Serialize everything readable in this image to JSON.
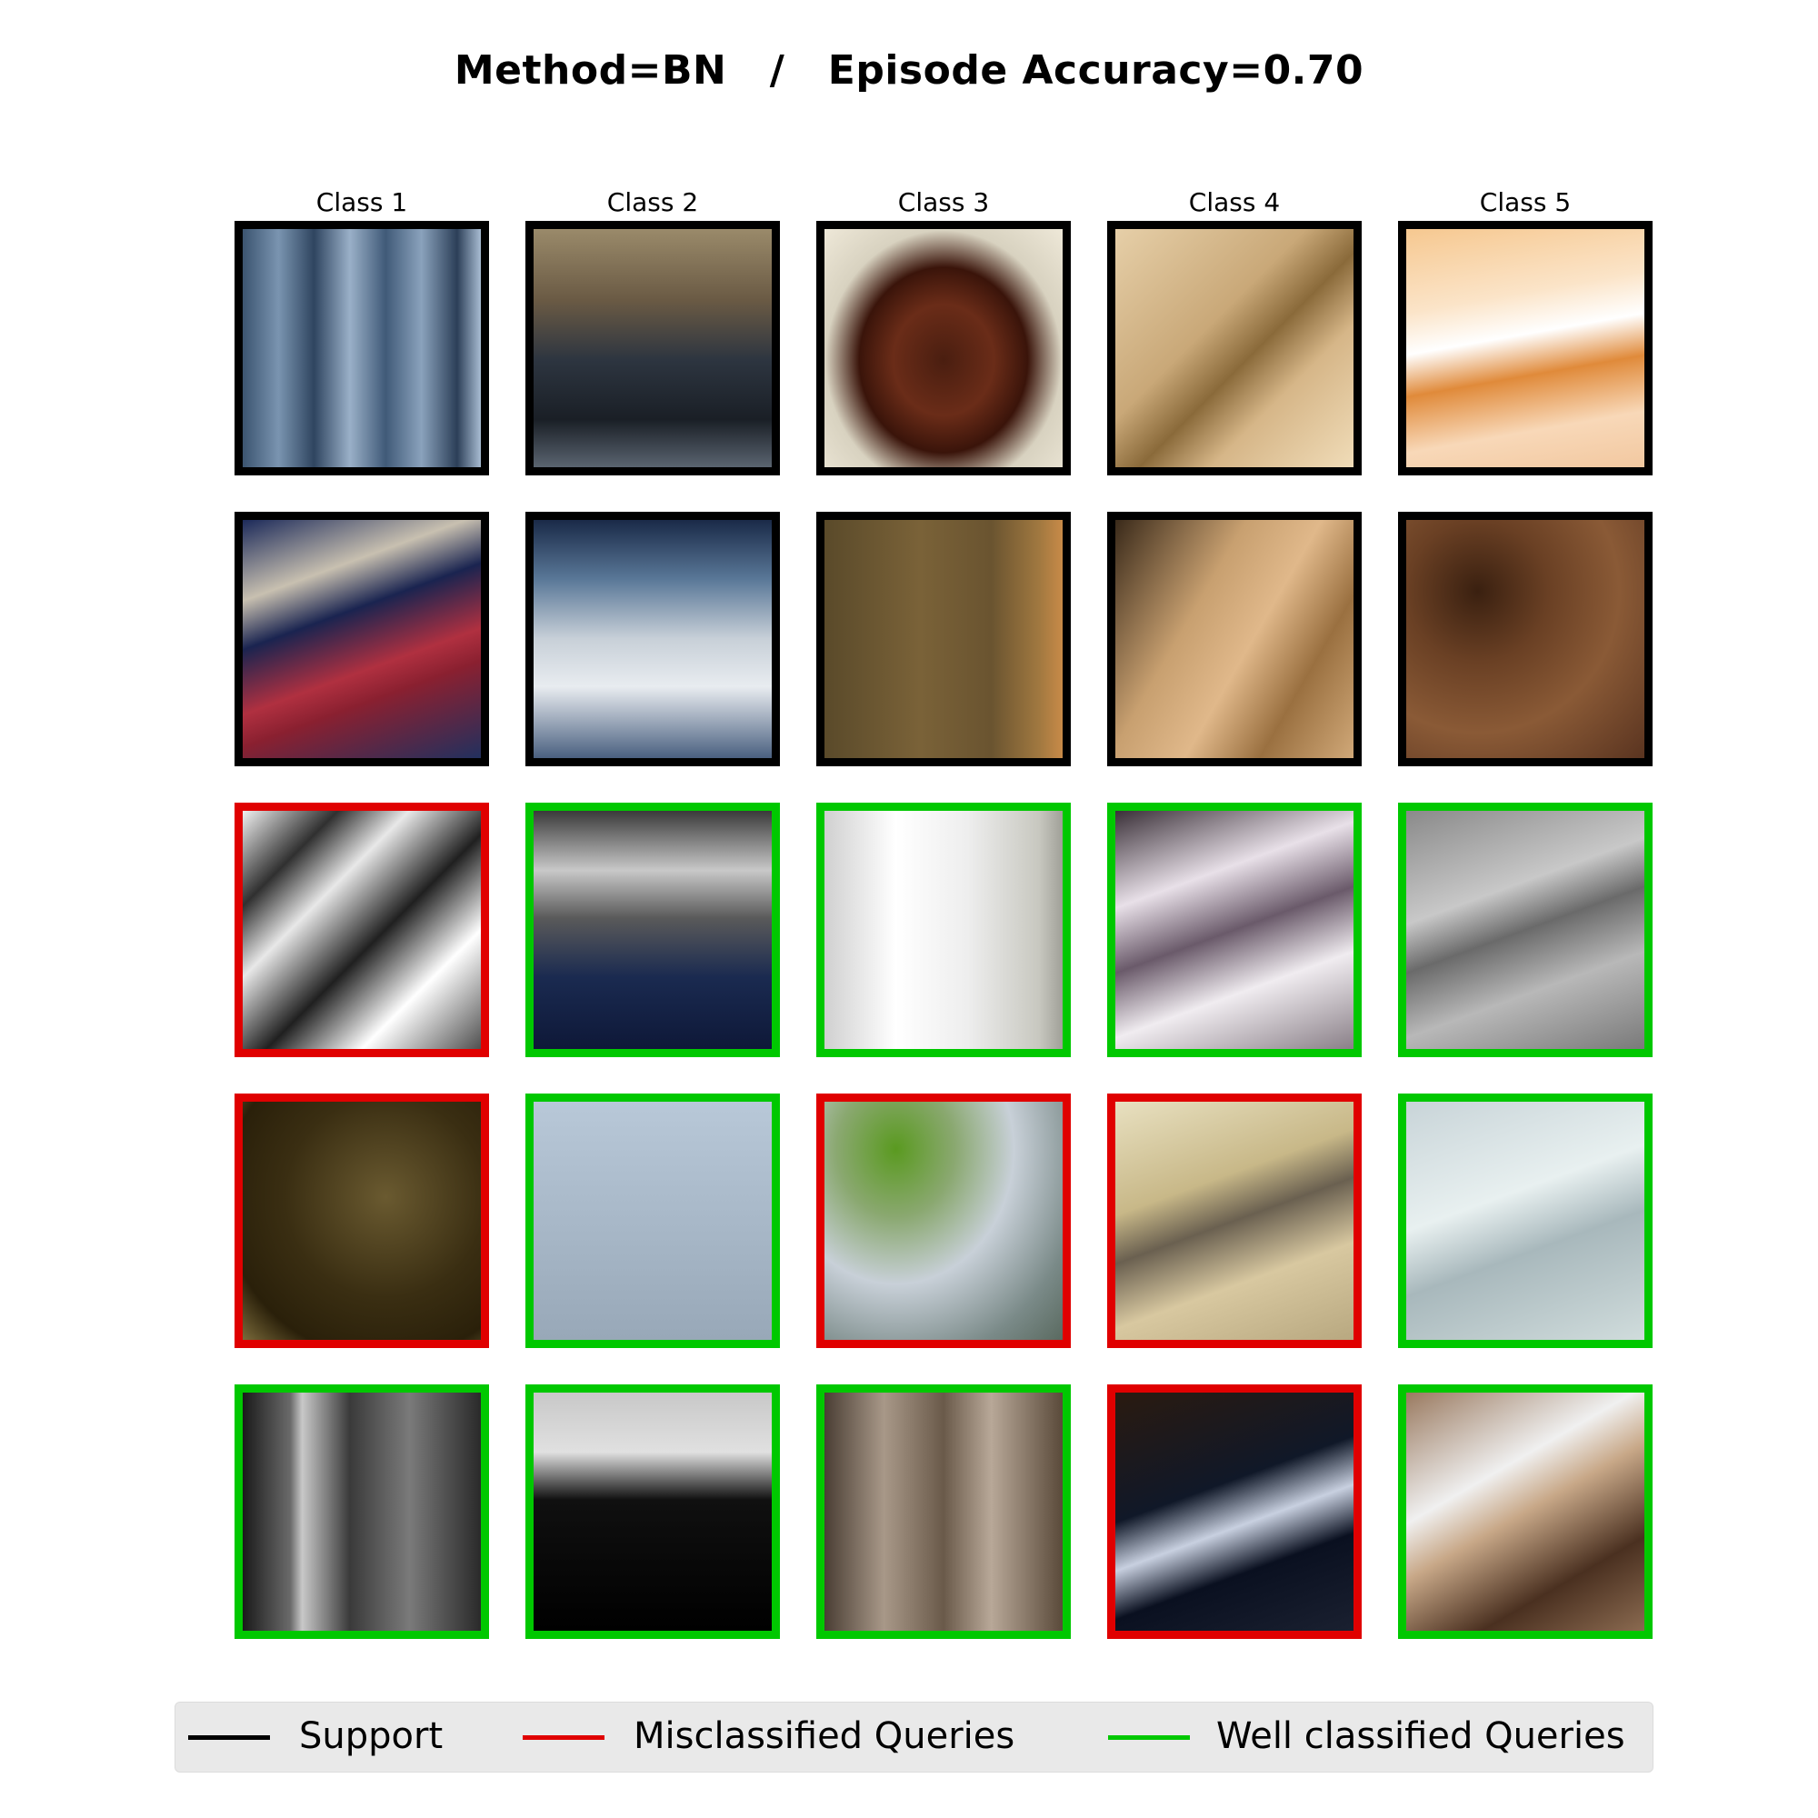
{
  "title": "Method=BN   /   Episode Accuracy=0.70",
  "columns": [
    "Class 1",
    "Class 2",
    "Class 3",
    "Class 4",
    "Class 5"
  ],
  "colors": {
    "support": "#000000",
    "misclassified": "#e00000",
    "well_classified": "#00c800",
    "legend_bg": "#e9e9e9"
  },
  "grid": [
    [
      "support",
      "support",
      "support",
      "support",
      "support"
    ],
    [
      "support",
      "support",
      "support",
      "support",
      "support"
    ],
    [
      "misclassified",
      "well_classified",
      "well_classified",
      "well_classified",
      "well_classified"
    ],
    [
      "misclassified",
      "well_classified",
      "misclassified",
      "misclassified",
      "well_classified"
    ],
    [
      "well_classified",
      "well_classified",
      "well_classified",
      "misclassified",
      "well_classified"
    ]
  ],
  "legend": {
    "support": "Support",
    "misclassified": "Misclassified Queries",
    "well_classified": "Well classified Queries"
  }
}
